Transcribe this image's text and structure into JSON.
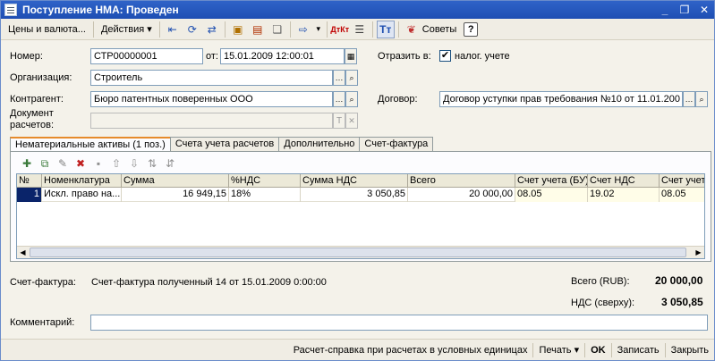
{
  "window": {
    "title": "Поступление НМА: Проведен"
  },
  "toolbar": {
    "prices_label": "Цены и валюта...",
    "actions_label": "Действия",
    "advice_label": "Советы",
    "help_label": "?"
  },
  "form": {
    "number_label": "Номер:",
    "number_value": "СТР00000001",
    "date_label": "от:",
    "date_value": "15.01.2009 12:00:01",
    "reflect_label": "Отразить в:",
    "tax_label": "налог. учете",
    "tax_checked": "✔",
    "org_label": "Организация:",
    "org_value": "Строитель",
    "contractor_label": "Контрагент:",
    "contractor_value": "Бюро патентных поверенных ООО",
    "contract_label": "Договор:",
    "contract_value": "Договор уступки прав требования №10 от 11.01.200",
    "doc_label_1": "Документ",
    "doc_label_2": "расчетов:",
    "doc_value": ""
  },
  "tabs": [
    {
      "label": "Нематериальные активы (1 поз.)"
    },
    {
      "label": "Счета учета расчетов"
    },
    {
      "label": "Дополнительно"
    },
    {
      "label": "Счет-фактура"
    }
  ],
  "table": {
    "columns": [
      "№",
      "Номенклатура",
      "Сумма",
      "%НДС",
      "Сумма НДС",
      "Всего",
      "Счет учета (БУ)",
      "Счет НДС",
      "Счет учет"
    ],
    "rows": [
      [
        "1",
        "Искл. право на...",
        "16 949,15",
        "18%",
        "3 050,85",
        "20 000,00",
        "08.05",
        "19.02",
        "08.05"
      ]
    ]
  },
  "summary": {
    "invoice_label": "Счет-фактура:",
    "invoice_value": "Счет-фактура полученный 14 от 15.01.2009 0:00:00",
    "total_label": "Всего (RUB):",
    "total_value": "20 000,00",
    "vat_label": "НДС (сверху):",
    "vat_value": "3 050,85",
    "comment_label": "Комментарий:",
    "comment_value": ""
  },
  "bottom": {
    "calc_label": "Расчет-справка при расчетах в условных единицах",
    "print_label": "Печать",
    "ok_label": "OK",
    "save_label": "Записать",
    "close_label": "Закрыть"
  }
}
